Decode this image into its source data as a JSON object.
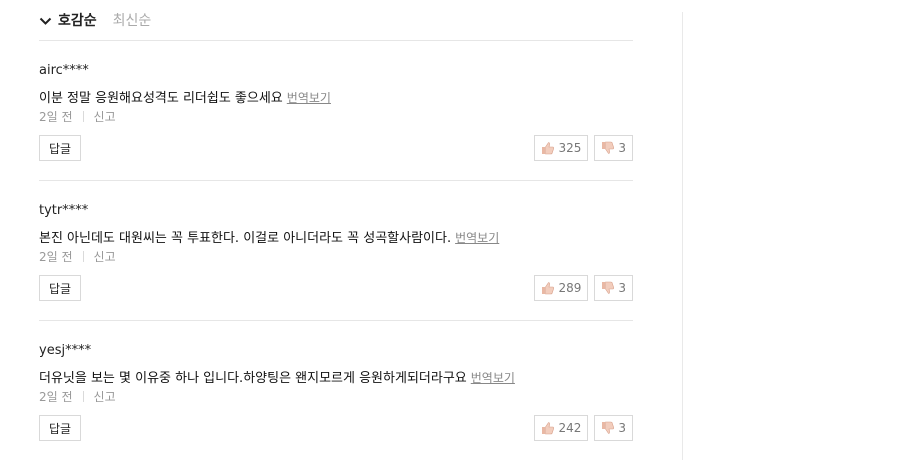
{
  "sort": {
    "active": "호감순",
    "inactive": "최신순"
  },
  "comments": [
    {
      "user": "airc****",
      "text": "이분 정말 응원해요성격도 리더쉽도 좋으세요",
      "translate": "번역보기",
      "date": "2일 전",
      "report": "신고",
      "reply": "답글",
      "likes": "325",
      "dislikes": "3"
    },
    {
      "user": "tytr****",
      "text": "본진 아닌데도 대원씨는 꼭 투표한다. 이걸로 아니더라도 꼭 성곡할사람이다.",
      "translate": "번역보기",
      "date": "2일 전",
      "report": "신고",
      "reply": "답글",
      "likes": "289",
      "dislikes": "3"
    },
    {
      "user": "yesj****",
      "text": "더유닛을 보는 몇 이유중 하나 입니다.하양팅은 왠지모르게 응원하게되더라구요",
      "translate": "번역보기",
      "date": "2일 전",
      "report": "신고",
      "reply": "답글",
      "likes": "242",
      "dislikes": "3"
    }
  ]
}
